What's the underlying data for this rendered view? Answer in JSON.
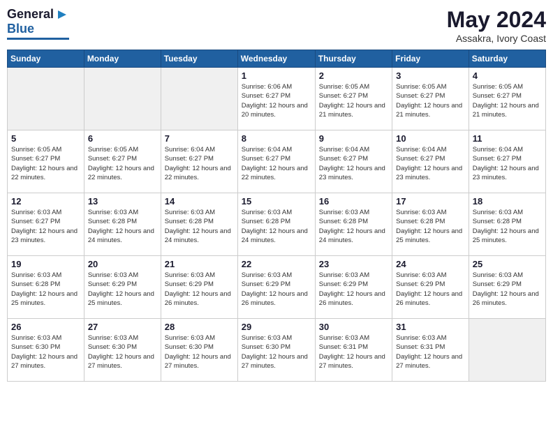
{
  "header": {
    "logo_general": "General",
    "logo_blue": "Blue",
    "month_year": "May 2024",
    "location": "Assakra, Ivory Coast"
  },
  "days_of_week": [
    "Sunday",
    "Monday",
    "Tuesday",
    "Wednesday",
    "Thursday",
    "Friday",
    "Saturday"
  ],
  "weeks": [
    [
      {
        "day": "",
        "empty": true
      },
      {
        "day": "",
        "empty": true
      },
      {
        "day": "",
        "empty": true
      },
      {
        "day": "1",
        "sunrise": "6:06 AM",
        "sunset": "6:27 PM",
        "daylight": "12 hours and 20 minutes."
      },
      {
        "day": "2",
        "sunrise": "6:05 AM",
        "sunset": "6:27 PM",
        "daylight": "12 hours and 21 minutes."
      },
      {
        "day": "3",
        "sunrise": "6:05 AM",
        "sunset": "6:27 PM",
        "daylight": "12 hours and 21 minutes."
      },
      {
        "day": "4",
        "sunrise": "6:05 AM",
        "sunset": "6:27 PM",
        "daylight": "12 hours and 21 minutes."
      }
    ],
    [
      {
        "day": "5",
        "sunrise": "6:05 AM",
        "sunset": "6:27 PM",
        "daylight": "12 hours and 22 minutes."
      },
      {
        "day": "6",
        "sunrise": "6:05 AM",
        "sunset": "6:27 PM",
        "daylight": "12 hours and 22 minutes."
      },
      {
        "day": "7",
        "sunrise": "6:04 AM",
        "sunset": "6:27 PM",
        "daylight": "12 hours and 22 minutes."
      },
      {
        "day": "8",
        "sunrise": "6:04 AM",
        "sunset": "6:27 PM",
        "daylight": "12 hours and 22 minutes."
      },
      {
        "day": "9",
        "sunrise": "6:04 AM",
        "sunset": "6:27 PM",
        "daylight": "12 hours and 23 minutes."
      },
      {
        "day": "10",
        "sunrise": "6:04 AM",
        "sunset": "6:27 PM",
        "daylight": "12 hours and 23 minutes."
      },
      {
        "day": "11",
        "sunrise": "6:04 AM",
        "sunset": "6:27 PM",
        "daylight": "12 hours and 23 minutes."
      }
    ],
    [
      {
        "day": "12",
        "sunrise": "6:03 AM",
        "sunset": "6:27 PM",
        "daylight": "12 hours and 23 minutes."
      },
      {
        "day": "13",
        "sunrise": "6:03 AM",
        "sunset": "6:28 PM",
        "daylight": "12 hours and 24 minutes."
      },
      {
        "day": "14",
        "sunrise": "6:03 AM",
        "sunset": "6:28 PM",
        "daylight": "12 hours and 24 minutes."
      },
      {
        "day": "15",
        "sunrise": "6:03 AM",
        "sunset": "6:28 PM",
        "daylight": "12 hours and 24 minutes."
      },
      {
        "day": "16",
        "sunrise": "6:03 AM",
        "sunset": "6:28 PM",
        "daylight": "12 hours and 24 minutes."
      },
      {
        "day": "17",
        "sunrise": "6:03 AM",
        "sunset": "6:28 PM",
        "daylight": "12 hours and 25 minutes."
      },
      {
        "day": "18",
        "sunrise": "6:03 AM",
        "sunset": "6:28 PM",
        "daylight": "12 hours and 25 minutes."
      }
    ],
    [
      {
        "day": "19",
        "sunrise": "6:03 AM",
        "sunset": "6:28 PM",
        "daylight": "12 hours and 25 minutes."
      },
      {
        "day": "20",
        "sunrise": "6:03 AM",
        "sunset": "6:29 PM",
        "daylight": "12 hours and 25 minutes."
      },
      {
        "day": "21",
        "sunrise": "6:03 AM",
        "sunset": "6:29 PM",
        "daylight": "12 hours and 26 minutes."
      },
      {
        "day": "22",
        "sunrise": "6:03 AM",
        "sunset": "6:29 PM",
        "daylight": "12 hours and 26 minutes."
      },
      {
        "day": "23",
        "sunrise": "6:03 AM",
        "sunset": "6:29 PM",
        "daylight": "12 hours and 26 minutes."
      },
      {
        "day": "24",
        "sunrise": "6:03 AM",
        "sunset": "6:29 PM",
        "daylight": "12 hours and 26 minutes."
      },
      {
        "day": "25",
        "sunrise": "6:03 AM",
        "sunset": "6:29 PM",
        "daylight": "12 hours and 26 minutes."
      }
    ],
    [
      {
        "day": "26",
        "sunrise": "6:03 AM",
        "sunset": "6:30 PM",
        "daylight": "12 hours and 27 minutes."
      },
      {
        "day": "27",
        "sunrise": "6:03 AM",
        "sunset": "6:30 PM",
        "daylight": "12 hours and 27 minutes."
      },
      {
        "day": "28",
        "sunrise": "6:03 AM",
        "sunset": "6:30 PM",
        "daylight": "12 hours and 27 minutes."
      },
      {
        "day": "29",
        "sunrise": "6:03 AM",
        "sunset": "6:30 PM",
        "daylight": "12 hours and 27 minutes."
      },
      {
        "day": "30",
        "sunrise": "6:03 AM",
        "sunset": "6:31 PM",
        "daylight": "12 hours and 27 minutes."
      },
      {
        "day": "31",
        "sunrise": "6:03 AM",
        "sunset": "6:31 PM",
        "daylight": "12 hours and 27 minutes."
      },
      {
        "day": "",
        "empty": true
      }
    ]
  ]
}
